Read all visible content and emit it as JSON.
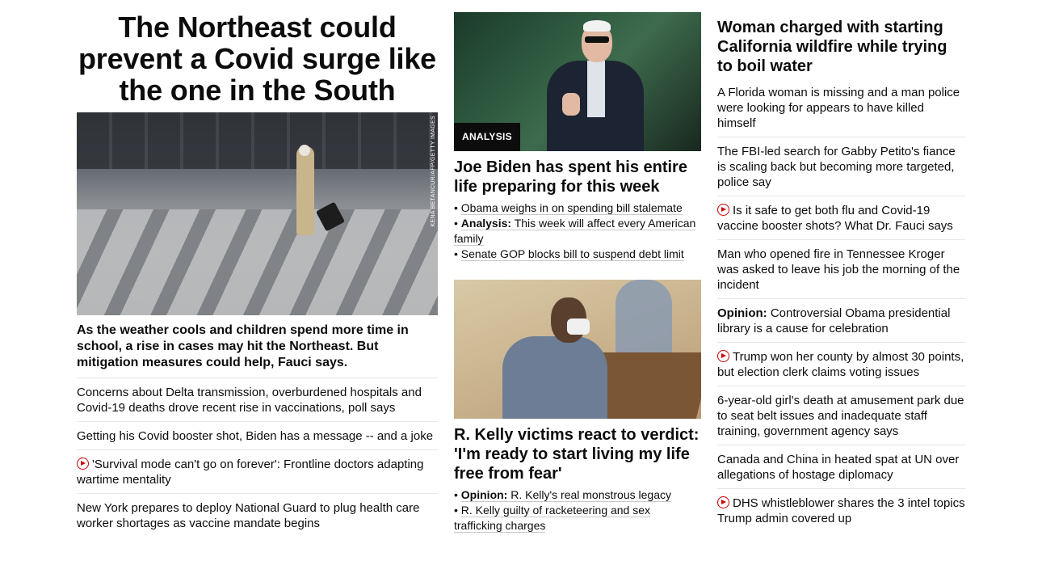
{
  "col1": {
    "headline": "The Northeast could prevent a Covid surge like the one in the South",
    "image_credit": "KENA BETANCUR/AFP/GETTY IMAGES",
    "description": "As the weather cools and children spend more time in school, a rise in cases may hit the Northeast. But mitigation measures could help, Fauci says.",
    "items": [
      {
        "text": "Concerns about Delta transmission, overburdened hospitals and Covid-19 deaths drove recent rise in vaccinations, poll says",
        "video": false
      },
      {
        "text": "Getting his Covid booster shot, Biden has a message -- and a joke",
        "video": false
      },
      {
        "text": "'Survival mode can't go on forever': Frontline doctors adapting wartime mentality",
        "video": true
      },
      {
        "text": "New York prepares to deploy National Guard to plug health care worker shortages as vaccine mandate begins",
        "video": false
      }
    ]
  },
  "col2": {
    "story1": {
      "badge": "ANALYSIS",
      "title": "Joe Biden has spent his entire life preparing for this week",
      "bullets": [
        {
          "prefix": "",
          "text": "Obama weighs in on spending bill stalemate"
        },
        {
          "prefix": "Analysis:",
          "text": "This week will affect every American family"
        },
        {
          "prefix": "",
          "text": "Senate GOP blocks bill to suspend debt limit"
        }
      ]
    },
    "story2": {
      "title": "R. Kelly victims react to verdict: 'I'm ready to start living my life free from fear'",
      "bullets": [
        {
          "prefix": "Opinion:",
          "text": "R. Kelly's real monstrous legacy"
        },
        {
          "prefix": "",
          "text": "R. Kelly guilty of racketeering and sex trafficking charges"
        }
      ]
    }
  },
  "col3": {
    "title": "Woman charged with starting California wildfire while trying to boil water",
    "items": [
      {
        "prefix": "",
        "text": "A Florida woman is missing and a man police were looking for appears to have killed himself",
        "video": false
      },
      {
        "prefix": "",
        "text": "The FBI-led search for Gabby Petito's fiance is scaling back but becoming more targeted, police say",
        "video": false
      },
      {
        "prefix": "",
        "text": "Is it safe to get both flu and Covid-19 vaccine booster shots? What Dr. Fauci says",
        "video": true
      },
      {
        "prefix": "",
        "text": "Man who opened fire in Tennessee Kroger was asked to leave his job the morning of the incident",
        "video": false
      },
      {
        "prefix": "Opinion:",
        "text": "Controversial Obama presidential library is a cause for celebration",
        "video": false
      },
      {
        "prefix": "",
        "text": "Trump won her county by almost 30 points, but election clerk claims voting issues",
        "video": true
      },
      {
        "prefix": "",
        "text": "6-year-old girl's death at amusement park due to seat belt issues and inadequate staff training, government agency says",
        "video": false
      },
      {
        "prefix": "",
        "text": "Canada and China in heated spat at UN over allegations of hostage diplomacy",
        "video": false
      },
      {
        "prefix": "",
        "text": "DHS whistleblower shares the 3 intel topics Trump admin covered up",
        "video": true
      }
    ]
  },
  "colors": {
    "video_icon": "#cc0000",
    "divider": "#e6e6e6",
    "text": "#0c0c0c"
  }
}
